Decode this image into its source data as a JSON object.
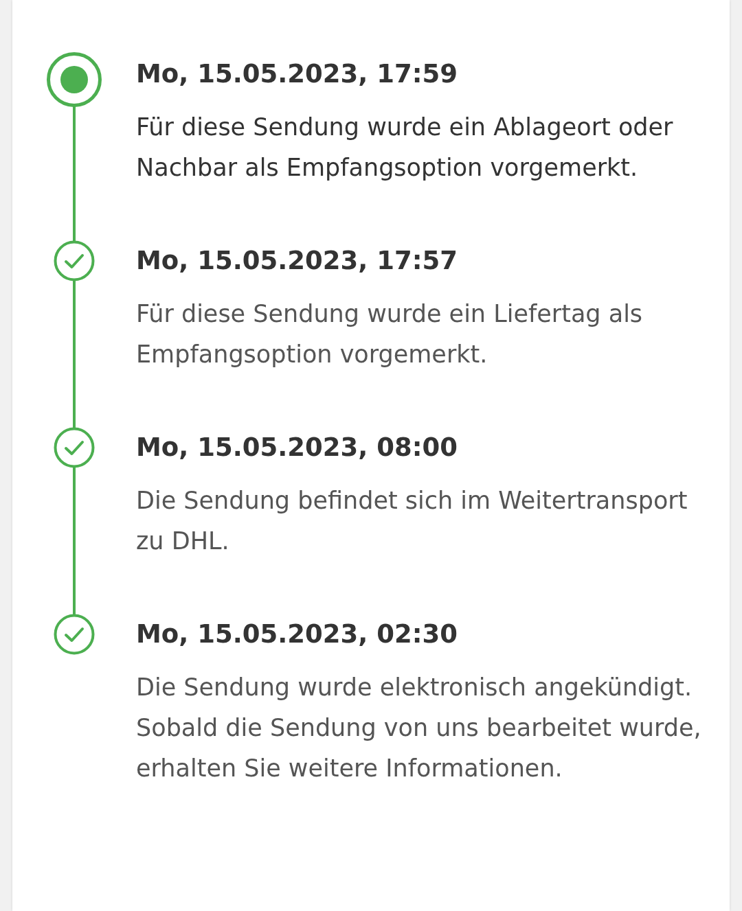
{
  "events": [
    {
      "kind": "current",
      "date": "Mo, 15.05.2023, 17:59",
      "text": "Für diese Sendung wurde ein Ablageort oder Nachbar als Empfangsoption vorgemerkt."
    },
    {
      "kind": "done",
      "date": "Mo, 15.05.2023, 17:57",
      "text": "Für diese Sendung wurde ein Liefertag als Empfangsoption vorgemerkt."
    },
    {
      "kind": "done",
      "date": "Mo, 15.05.2023, 08:00",
      "text": "Die Sendung befindet sich im Weitertransport zu DHL."
    },
    {
      "kind": "done",
      "date": "Mo, 15.05.2023, 02:30",
      "text": "Die Sendung wurde elektronisch angekündigt. Sobald die Sendung von uns bearbeitet wurde, erhalten Sie weitere Informationen."
    }
  ]
}
